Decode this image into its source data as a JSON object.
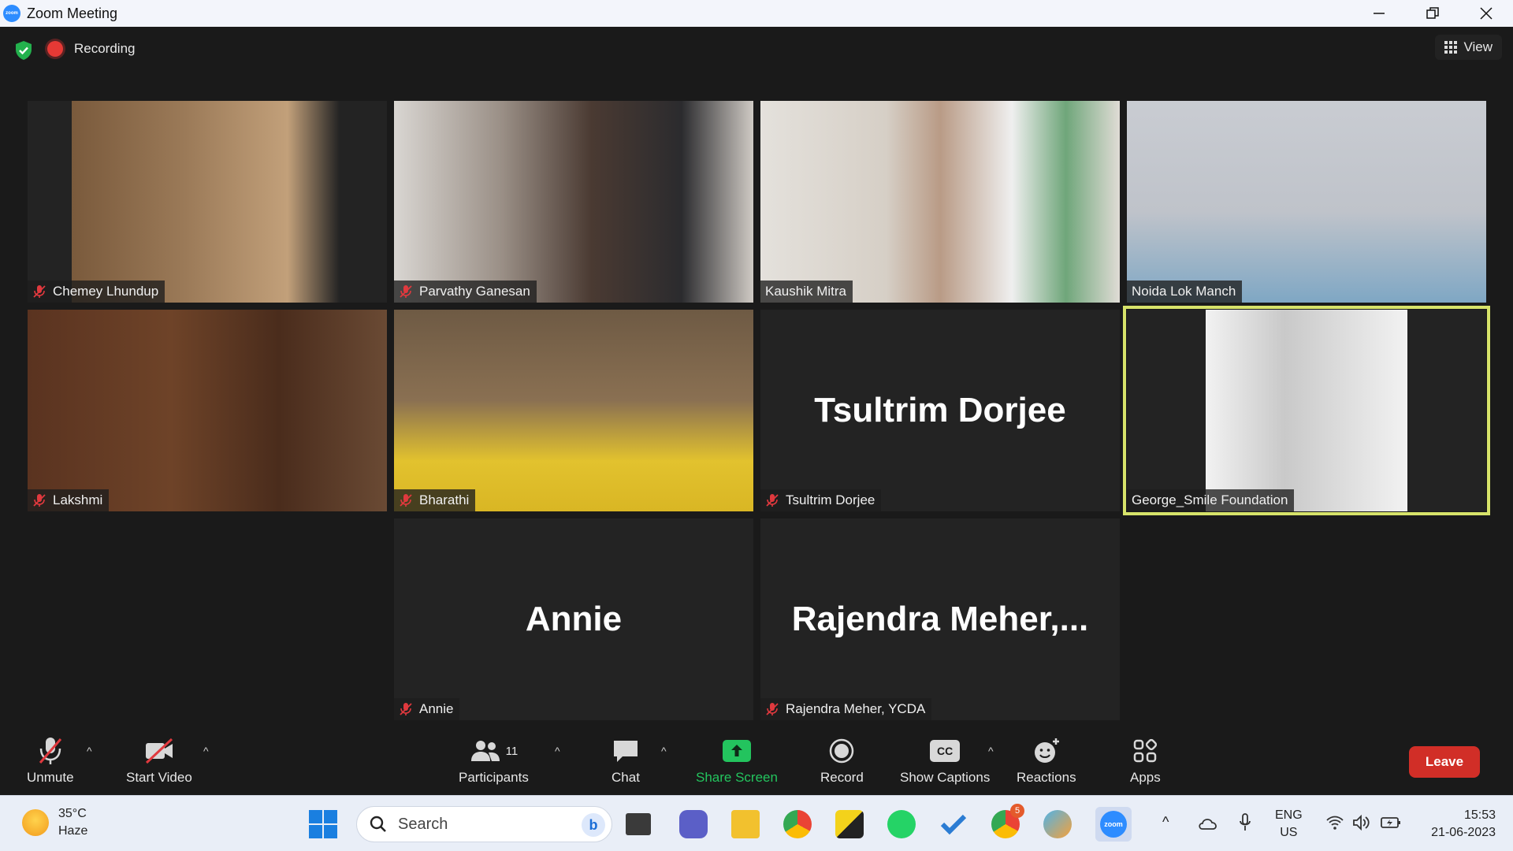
{
  "window": {
    "title": "Zoom Meeting",
    "app_icon_text": "zoom"
  },
  "meeting": {
    "recording_label": "Recording",
    "view_label": "View"
  },
  "participants": [
    {
      "name": "Chemey Lhundup",
      "muted": true,
      "video": true,
      "tint": "#8a6a4a"
    },
    {
      "name": "Parvathy Ganesan",
      "muted": true,
      "video": true,
      "tint": "#6f6a66"
    },
    {
      "name": "Kaushik Mitra",
      "muted": false,
      "video": true,
      "tint": "#b9b3a8"
    },
    {
      "name": "Noida Lok Manch",
      "muted": false,
      "video": true,
      "tint": "#a9b3bd"
    },
    {
      "name": "Lakshmi",
      "muted": true,
      "video": true,
      "tint": "#5a3a26"
    },
    {
      "name": "Bharathi",
      "muted": true,
      "video": true,
      "tint": "#7a6648"
    },
    {
      "name": "Tsultrim Dorjee",
      "muted": true,
      "video": false,
      "display": "Tsultrim Dorjee"
    },
    {
      "name": "George_Smile Foundation",
      "muted": false,
      "video": true,
      "tint": "#cfcfcf",
      "active": true
    },
    {
      "name": "Annie",
      "muted": true,
      "video": false,
      "display": "Annie"
    },
    {
      "name": "Rajendra Meher, YCDA",
      "muted": true,
      "video": false,
      "display": "Rajendra  Meher,..."
    }
  ],
  "toolbar": {
    "unmute": "Unmute",
    "start_video": "Start Video",
    "participants": "Participants",
    "participants_count": "11",
    "chat": "Chat",
    "share_screen": "Share Screen",
    "record": "Record",
    "show_captions": "Show Captions",
    "captions_icon_text": "CC",
    "reactions": "Reactions",
    "apps": "Apps",
    "leave": "Leave"
  },
  "taskbar": {
    "temperature": "35°C",
    "weather": "Haze",
    "search_placeholder": "Search",
    "chrome_badge": "5",
    "language_top": "ENG",
    "language_bottom": "US",
    "time": "15:53",
    "date": "21-06-2023"
  },
  "colors": {
    "accent_zoom": "#2d8cff",
    "share_green": "#23c45e",
    "leave_red": "#d12e27",
    "active_speaker": "#d7e36a",
    "mic_off_red": "#e0393e"
  }
}
